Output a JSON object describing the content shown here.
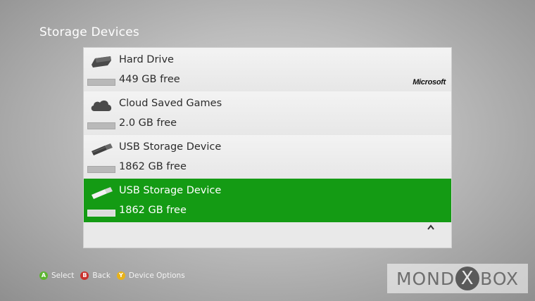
{
  "header": {
    "title": "Storage Devices"
  },
  "devices": [
    {
      "name": "Hard Drive",
      "free": "449 GB free",
      "icon": "hard-drive-icon",
      "brand": "Microsoft",
      "selected": false
    },
    {
      "name": "Cloud Saved Games",
      "free": "2.0 GB free",
      "icon": "cloud-icon",
      "selected": false
    },
    {
      "name": "USB Storage Device",
      "free": "1862 GB free",
      "icon": "usb-drive-icon",
      "selected": false
    },
    {
      "name": "USB Storage Device",
      "free": "1862 GB free",
      "icon": "usb-drive-icon",
      "selected": true
    }
  ],
  "footer": {
    "hints": [
      {
        "button": "A",
        "label": "Select",
        "color": "#5cb531"
      },
      {
        "button": "B",
        "label": "Back",
        "color": "#c9302c"
      },
      {
        "button": "Y",
        "label": "Device Options",
        "color": "#e8b219"
      }
    ]
  },
  "watermark": {
    "left": "MOND",
    "x": "X",
    "right": "BOX"
  },
  "colors": {
    "selected": "#149b14",
    "panel": "#e9e9e9"
  }
}
